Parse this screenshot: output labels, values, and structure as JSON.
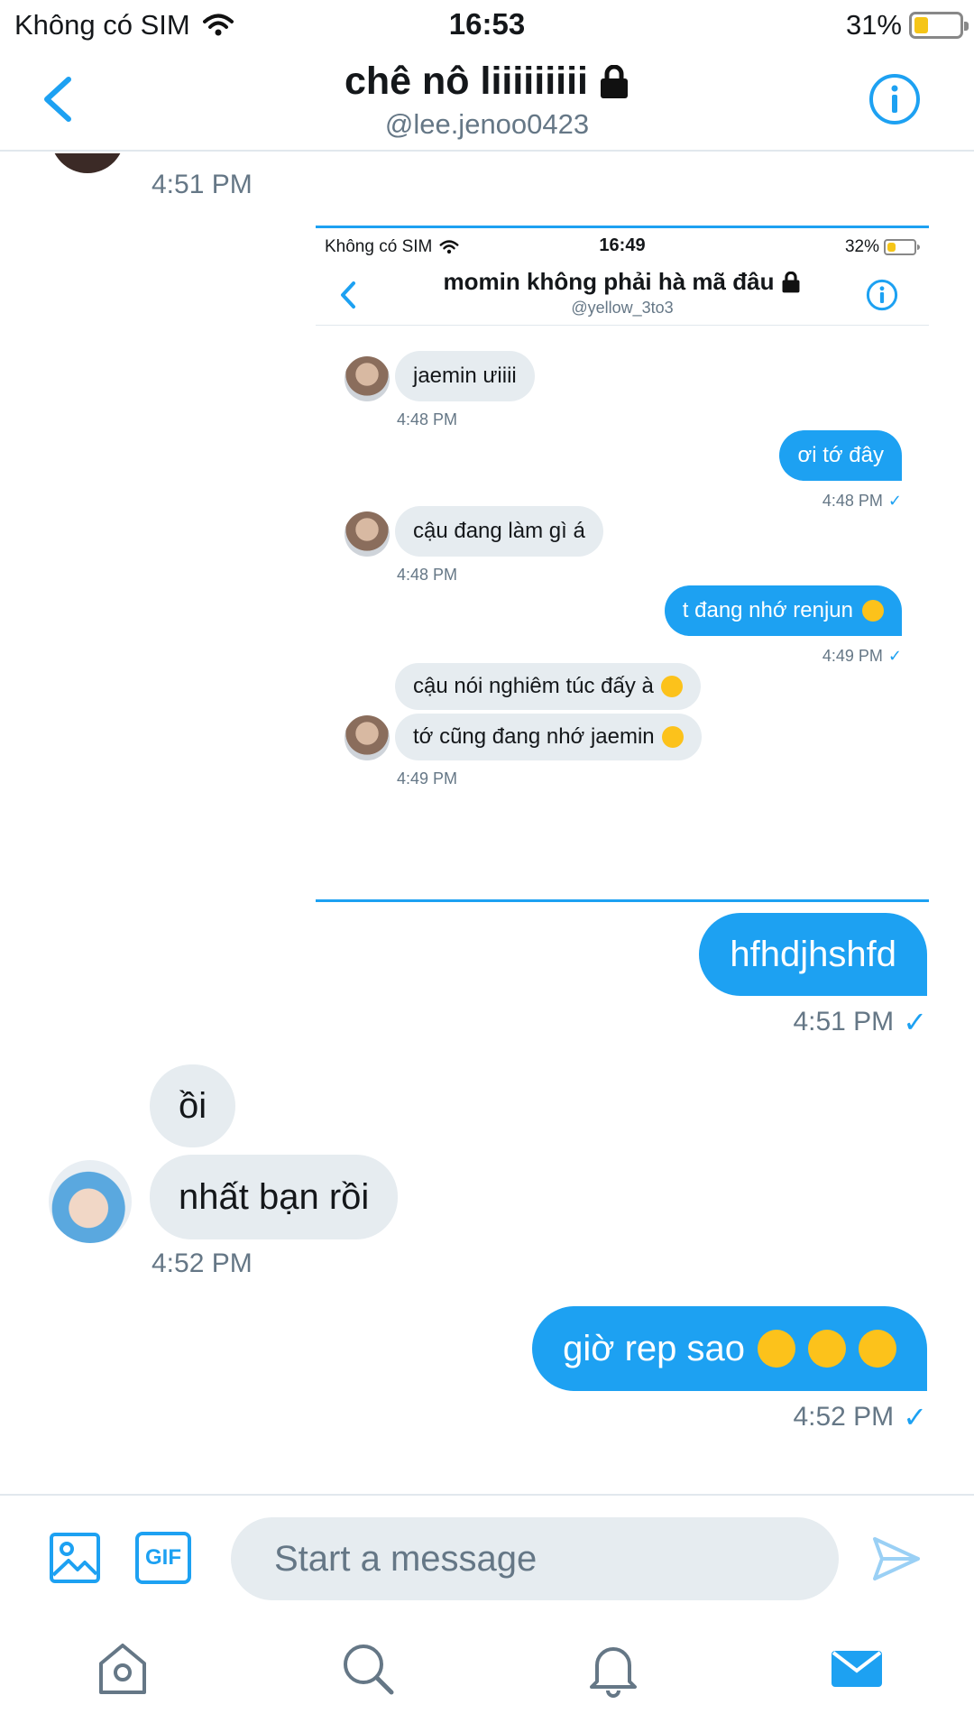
{
  "status_bar": {
    "carrier": "Không có SIM",
    "time": "16:53",
    "battery": "31%",
    "battery_level": 0.31
  },
  "header": {
    "title": "chê nô liiiiiiiii",
    "handle": "@lee.jenoo0423"
  },
  "messages": {
    "top_time": "4:51 PM",
    "sent_1": "hfhdjhshfd",
    "sent_1_time": "4:51 PM",
    "recv_1": "ồi",
    "recv_2": "nhất bạn rồi",
    "recv_time": "4:52 PM",
    "sent_2": "giờ rep sao",
    "sent_2_time": "4:52 PM"
  },
  "embedded_screenshot": {
    "carrier": "Không có SIM",
    "time": "16:49",
    "battery": "32%",
    "battery_level": 0.32,
    "title": "momin không phải hà mã đâu",
    "handle": "@yellow_3to3",
    "messages": [
      {
        "side": "left",
        "text": "jaemin ưiiii",
        "time": "4:48 PM"
      },
      {
        "side": "right",
        "text": "ơi tớ đây",
        "time": "4:48 PM"
      },
      {
        "side": "left",
        "text": "cậu đang làm gì á",
        "time": "4:48 PM"
      },
      {
        "side": "right",
        "text": "t đang nhớ renjun",
        "time": "4:49 PM"
      },
      {
        "side": "left",
        "text": "cậu nói nghiêm túc đấy à"
      },
      {
        "side": "left",
        "text": "tớ cũng đang nhớ jaemin",
        "time": "4:49 PM"
      }
    ]
  },
  "composer": {
    "placeholder": "Start a message",
    "gif_label": "GIF"
  },
  "colors": {
    "accent": "#1da1f2",
    "bubble_received": "#e6ecf0",
    "muted_text": "#657786"
  },
  "icons": [
    "back-icon",
    "info-icon",
    "lock-icon",
    "media-icon",
    "send-icon",
    "home-icon",
    "search-icon",
    "notifications-icon",
    "messages-icon"
  ]
}
